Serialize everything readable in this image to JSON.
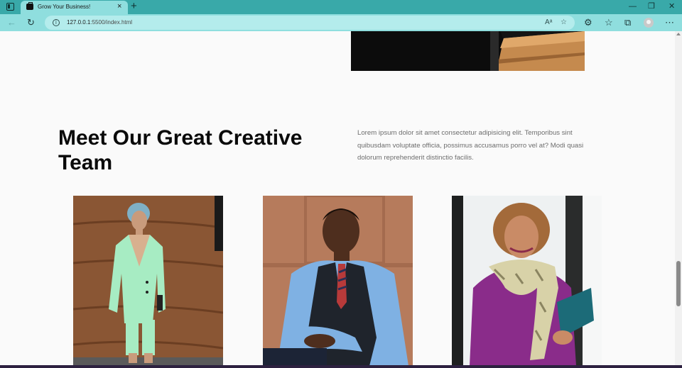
{
  "browser": {
    "tab_title": "Grow Your Business!",
    "close_tab_symbol": "×",
    "new_tab_symbol": "+",
    "url_host": "127.0.0.1",
    "url_rest": ":5500/index.html",
    "icons": [
      "window-menu-icon",
      "back-icon",
      "reload-icon",
      "info-icon",
      "read-aloud-icon",
      "add-favorite-icon",
      "extensions-icon",
      "favorites-icon",
      "collections-icon",
      "profile-avatar",
      "more-icon",
      "minimize-icon",
      "restore-icon",
      "close-window-icon"
    ]
  },
  "team_section": {
    "heading": "Meet Our Great Creative Team",
    "intro": "Lorem ipsum dolor sit amet consectetur adipisicing elit. Temporibus sint quibusdam voluptate officia, possimus accusamus porro vel at? Modi quasi dolorum reprehenderit distinctio facilis.",
    "members": [
      {
        "photo": "team-member-1-photo"
      },
      {
        "photo": "team-member-2-photo"
      },
      {
        "photo": "team-member-3-photo"
      }
    ]
  },
  "colors": {
    "chrome": "#39a9a9",
    "toolbar": "#8fdede",
    "omnibox": "#b4ecec",
    "heading": "#0a0a0a",
    "body_text": "#6d6d6d"
  }
}
